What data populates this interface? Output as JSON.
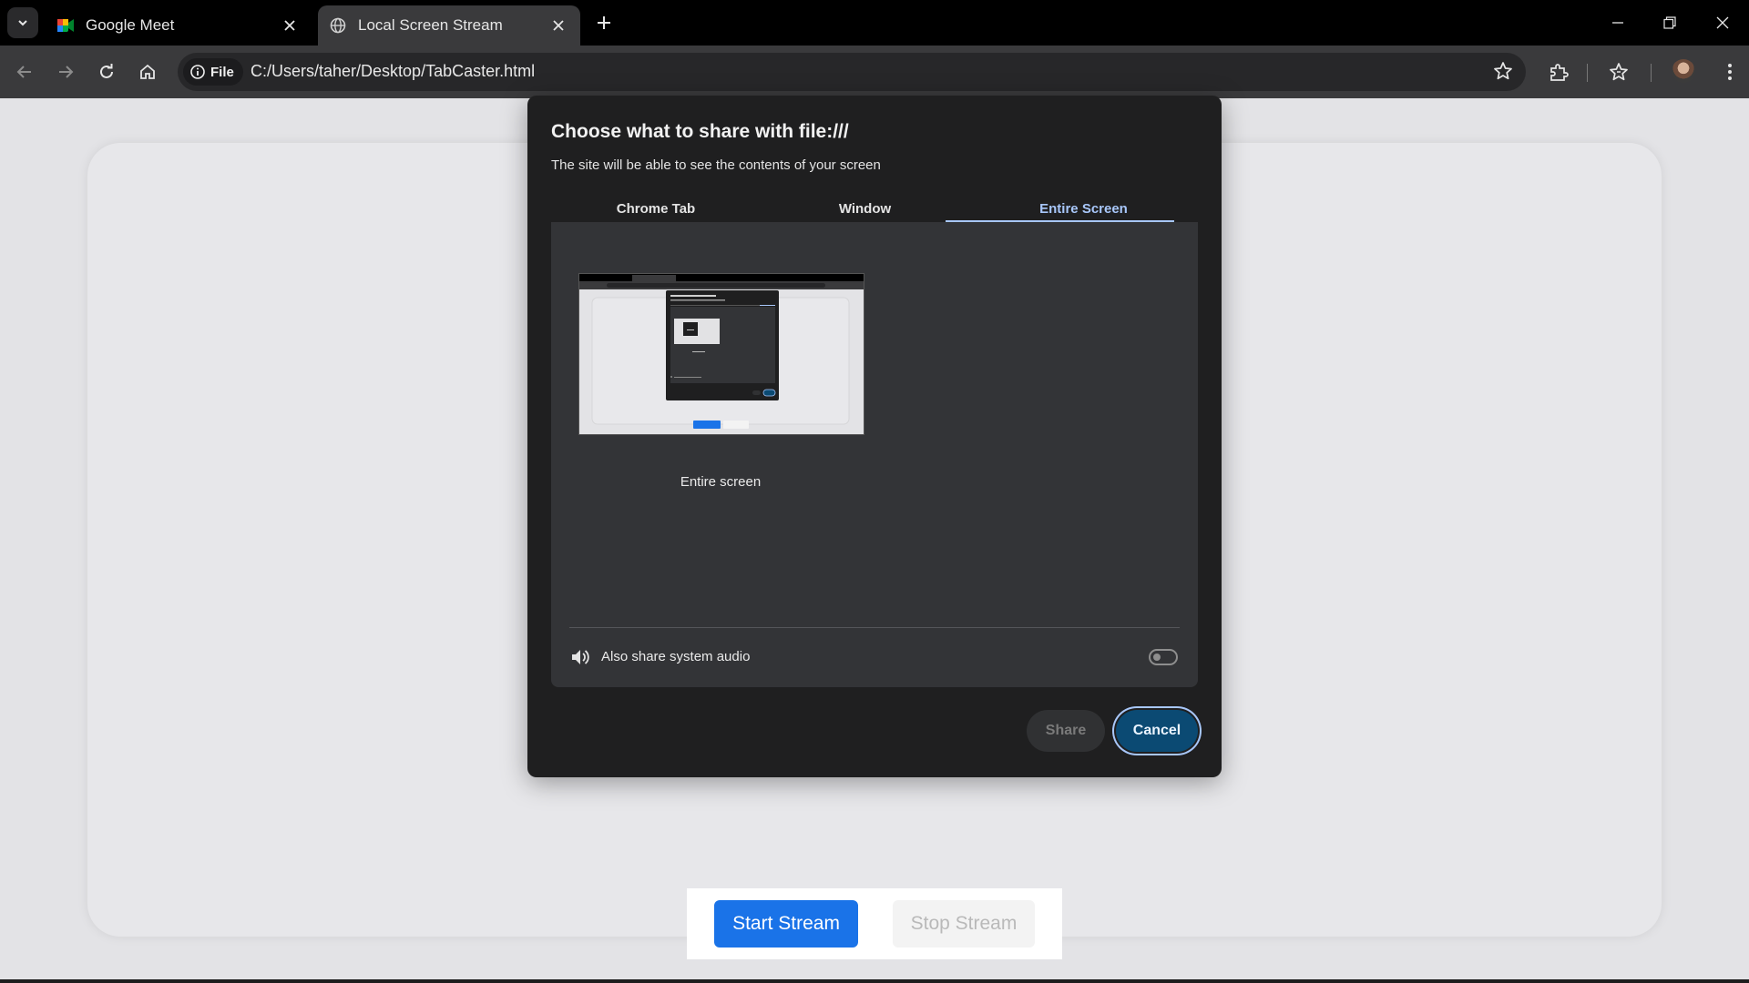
{
  "browser": {
    "tabs": [
      {
        "title": "Google Meet",
        "favicon": "google-meet-icon",
        "active": false
      },
      {
        "title": "Local Screen Stream",
        "favicon": "globe-icon",
        "active": true
      }
    ],
    "address_chip": "File",
    "url": "C:/Users/taher/Desktop/TabCaster.html"
  },
  "dialog": {
    "title": "Choose what to share with file:///",
    "subtitle": "The site will be able to see the contents of your screen",
    "tabs": [
      "Chrome Tab",
      "Window",
      "Entire Screen"
    ],
    "selected_tab": "Entire Screen",
    "source_label": "Entire screen",
    "audio_label": "Also share system audio",
    "audio_enabled": false,
    "share_label": "Share",
    "cancel_label": "Cancel"
  },
  "page": {
    "start_label": "Start Stream",
    "stop_label": "Stop Stream"
  },
  "colors": {
    "accent": "#1a73e8",
    "selected_tab": "#a8c7fa",
    "cancel_bg": "#0b4a73"
  }
}
